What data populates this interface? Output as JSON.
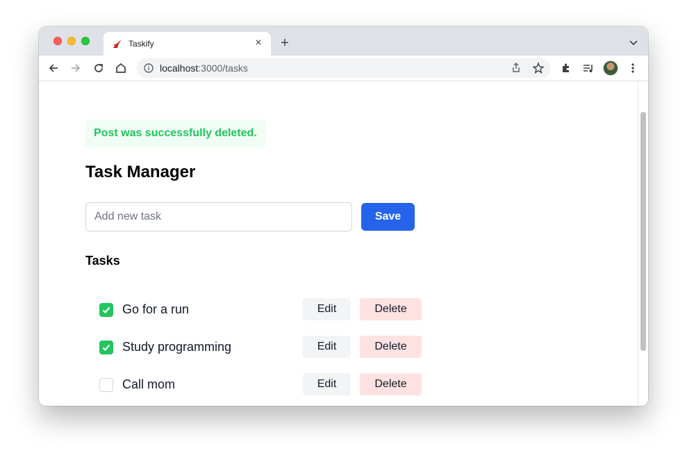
{
  "browser": {
    "tab": {
      "title": "Taskify",
      "icon": "taskify-logo-icon"
    },
    "url": {
      "host": "localhost",
      "path": ":3000/tasks"
    },
    "accent": "#2563eb"
  },
  "page": {
    "flash_message": "Post was successfully deleted.",
    "title": "Task Manager",
    "new_task": {
      "placeholder": "Add new task",
      "value": ""
    },
    "save_label": "Save",
    "tasks_heading": "Tasks",
    "edit_label": "Edit",
    "delete_label": "Delete",
    "tasks": [
      {
        "label": "Go for a run",
        "done": true
      },
      {
        "label": "Study programming",
        "done": true
      },
      {
        "label": "Call mom",
        "done": false
      }
    ]
  },
  "colors": {
    "flash_text": "#22c55e",
    "flash_bg": "#f0fdf4",
    "save_bg": "#2563eb",
    "delete_bg": "#fee2e2",
    "edit_bg": "#f3f4f6",
    "checkbox_checked": "#22c55e"
  }
}
